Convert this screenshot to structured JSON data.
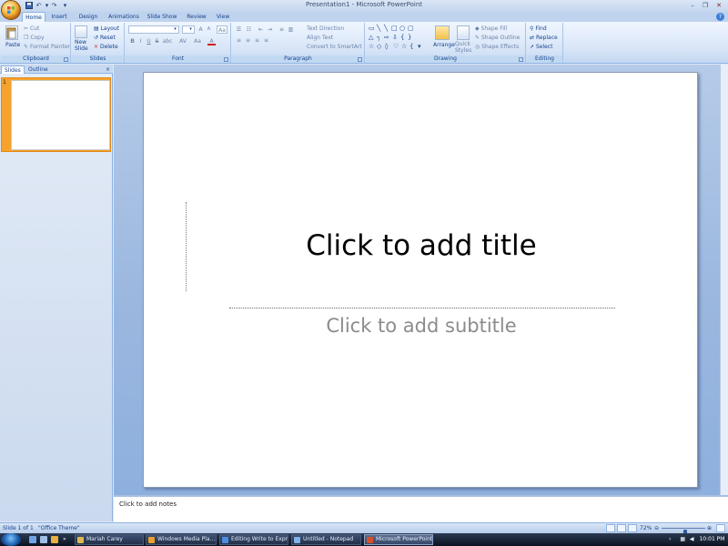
{
  "window": {
    "title": "Presentation1 - Microsoft PowerPoint",
    "qat_icons": [
      "save-icon",
      "undo-icon",
      "redo-icon",
      "customize-qat-icon"
    ]
  },
  "ribbon": {
    "tabs": [
      {
        "label": "Home",
        "active": true
      },
      {
        "label": "Insert"
      },
      {
        "label": "Design"
      },
      {
        "label": "Animations"
      },
      {
        "label": "Slide Show"
      },
      {
        "label": "Review"
      },
      {
        "label": "View"
      }
    ],
    "clipboard": {
      "group_label": "Clipboard",
      "paste": "Paste",
      "cut": "Cut",
      "copy": "Copy",
      "format_painter": "Format Painter"
    },
    "slides": {
      "group_label": "Slides",
      "new_slide": "New Slide",
      "layout": "Layout",
      "reset": "Reset",
      "delete": "Delete"
    },
    "font": {
      "group_label": "Font",
      "font_name": "",
      "font_size": "",
      "grow": "A",
      "shrink": "A",
      "clear": "Aa",
      "bold": "B",
      "italic": "I",
      "underline": "U",
      "strike": "S",
      "shadow": "abc",
      "spacing": "AV",
      "case": "Aa",
      "color": "A"
    },
    "paragraph": {
      "group_label": "Paragraph",
      "text_direction": "Text Direction",
      "align_text": "Align Text",
      "convert_smartart": "Convert to SmartArt"
    },
    "drawing": {
      "group_label": "Drawing",
      "arrange": "Arrange",
      "quick_styles": "Quick Styles",
      "shape_fill": "Shape Fill",
      "shape_outline": "Shape Outline",
      "shape_effects": "Shape Effects"
    },
    "editing": {
      "group_label": "Editing",
      "find": "Find",
      "replace": "Replace",
      "select": "Select"
    }
  },
  "left_pane": {
    "tabs": [
      "Slides",
      "Outline"
    ],
    "close": "×",
    "thumbnails": [
      {
        "number": "1"
      }
    ]
  },
  "slide": {
    "title_placeholder": "Click to add title",
    "subtitle_placeholder": "Click to add subtitle"
  },
  "notes": {
    "placeholder": "Click to add notes"
  },
  "status_bar": {
    "slide_info": "Slide 1 of 1",
    "theme": "\"Office Theme\"",
    "zoom": "72%",
    "zoom_fraction": 0.55
  },
  "taskbar": {
    "tasks": [
      {
        "label": "Mariah Carey",
        "icon_color": "#e0b850"
      },
      {
        "label": "Windows Media Pla...",
        "icon_color": "#e8a030"
      },
      {
        "label": "Editing Write to Expre...",
        "icon_color": "#4a8ee0"
      },
      {
        "label": "Untitled - Notepad",
        "icon_color": "#7fb3e8"
      },
      {
        "label": "Microsoft PowerPoint...",
        "icon_color": "#d8502a",
        "active": true
      }
    ],
    "clock": "10:01 PM"
  }
}
